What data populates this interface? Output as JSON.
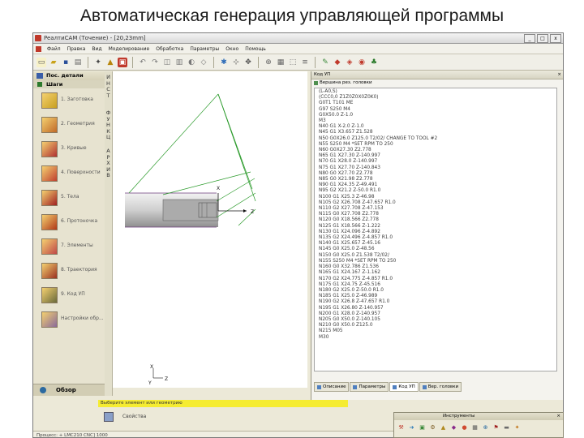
{
  "slide_title": "Автоматическая генерация управляющей программы",
  "window": {
    "title": "PeaлтиCAM (Точение) - [20,23mm]",
    "controls": [
      "_",
      "□",
      "x"
    ]
  },
  "menu": [
    "Файл",
    "Правка",
    "Вид",
    "Моделирование",
    "Обработка",
    "Параметры",
    "Окно",
    "Помощь"
  ],
  "left_panel": {
    "header": "Пос. детали",
    "sub": "Шаги",
    "steps": [
      {
        "label": "1. Заготовка",
        "color": "#c8a020"
      },
      {
        "label": "2. Геометрия",
        "color": "#c06a28"
      },
      {
        "label": "3. Кривые",
        "color": "#b03030"
      },
      {
        "label": "4. Поверхности",
        "color": "#c04030"
      },
      {
        "label": "5. Тела",
        "color": "#a02020"
      },
      {
        "label": "6. Протоночка",
        "color": "#b03818"
      },
      {
        "label": "7. Элементы",
        "color": "#c04848"
      },
      {
        "label": "8. Траектория",
        "color": "#9a3020"
      },
      {
        "label": "9. Код УП",
        "color": "#6a6a3a"
      },
      {
        "label": "Настройки обр...",
        "color": "#8a6a9a"
      }
    ],
    "bottom_label": "Обзор"
  },
  "vertical_tabs": [
    {
      "text": "И\nН\nС\nТ"
    },
    {
      "text": "Ф\nУ\nН\nК\nЦ"
    },
    {
      "text": "А\nР\nХ\nИ\nВ"
    }
  ],
  "graphics": {
    "axis_label_z": "Z",
    "axis_label_x": "X",
    "triad_y": "Y",
    "triad_z": "Z",
    "triad_x": "X",
    "tool_color": "#2a9a2a",
    "part_color": "#9b9b9b"
  },
  "status_message": "Выберите элемент или геометрию",
  "code_panel": {
    "header": "Код УП",
    "subheader": "Вершина рез. головки",
    "lines": [
      "(L-A0,S)",
      "(CCC0,0 Z1Z0Z0X0Z0K0)",
      "G0T1 T101 ME",
      "G97 S250 M4",
      "G0X50.0 Z-1.0",
      "M3",
      "N40 G1 X-2.0 Z-1.0",
      "N45 G1 X3.657 Z1.528",
      "N50 G0X26.0 Z125.0 T2/02/ CHANGE TO TOOL #2",
      "N55 S250 M4 *SET RPM TO 250",
      "N60 G0X27.30 Z2.778",
      "N65 G1 X27.30 Z-140.997",
      "N70 G1 X28.0 Z-140.997",
      "N75 G1 X27.70 Z-140.843",
      "N80 G0 X27.70 Z2.778",
      "N85 G0 X21.98 Z2.778",
      "N90 G1 X24.35 Z-49.491",
      "N95 G2 X21.2 Z-50.0 R1.0",
      "N100 G1 X25.3 Z-46.98",
      "N105 G2 X26.708 Z-47.657 R1.0",
      "N110 G2 X27.708 Z-47.153",
      "N115 G0 X27.708 Z2.778",
      "N120 G0 X18.566 Z2.778",
      "N125 G1 X18.566 Z-1.222",
      "N130 G1 X24.096 Z-4.892",
      "N135 G2 X24.496 Z-4.857 R1.0",
      "N140 G1 X25.657 Z-45.16",
      "N145 G0 X25.0 Z-48.56",
      "N150 G0 X25.0 Z1.538 T2/02/",
      "N155 S250 M4 *SET RPM TO 250",
      "N160 G0 X32.786 Z1.536",
      "N165 G1 X24.167 Z-1.162",
      "N170 G2 X24.775 Z-4.857 R1.0",
      "N175 G1 X24.75 Z-45.516",
      "N180 G2 X25.0 Z-50.0 R1.0",
      "N185 G1 X25.0 Z-46.989",
      "N190 G2 X26.8 Z-47.657 R1.0",
      "N195 G1 X26.80 Z-140.957",
      "N200 G1 X28.0 Z-140.957",
      "N205 G0 X50.0 Z-140.105",
      "N210 G0 X50.0 Z125.0",
      "N215 M05",
      "M30"
    ],
    "tabs": [
      "Описание",
      "Параметры",
      "Код УП",
      "Вер. головки"
    ],
    "active_tab": 2
  },
  "bottom_dock_label": "Свойства",
  "taskbar_text": "Процесс: + LMC210 CNC] 1000",
  "instruments": {
    "title": "Инструменты",
    "buttons": [
      {
        "icon": "wrench-icon",
        "glyph": "⚒",
        "color": "#c0392b"
      },
      {
        "icon": "arrow-icon",
        "glyph": "➜",
        "color": "#2a7ab8"
      },
      {
        "icon": "cube-icon",
        "glyph": "▣",
        "color": "#3a8a3a"
      },
      {
        "icon": "gear-icon",
        "glyph": "⚙",
        "color": "#7a5a20"
      },
      {
        "icon": "tool-icon",
        "glyph": "▲",
        "color": "#b08a20"
      },
      {
        "icon": "pin-icon",
        "glyph": "◆",
        "color": "#8a2a8a"
      },
      {
        "icon": "palette-icon",
        "glyph": "●",
        "color": "#d04a30"
      },
      {
        "icon": "grid-icon",
        "glyph": "▦",
        "color": "#555555"
      },
      {
        "icon": "zoom-icon",
        "glyph": "⊕",
        "color": "#2a6aa0"
      },
      {
        "icon": "flag-icon",
        "glyph": "⚑",
        "color": "#a02020"
      },
      {
        "icon": "ruler-icon",
        "glyph": "▬",
        "color": "#6a6a6a"
      },
      {
        "icon": "star-icon",
        "glyph": "✦",
        "color": "#c07010"
      }
    ]
  }
}
